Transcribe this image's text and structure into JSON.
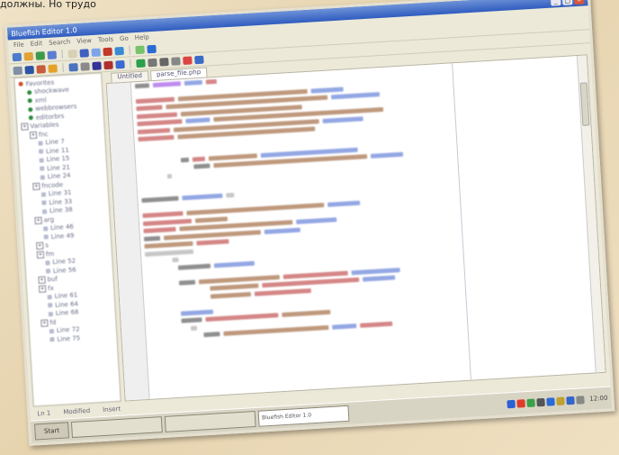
{
  "caption": "должны. Но трудо",
  "window": {
    "title": "Bluefish Editor 1.0",
    "min": "_",
    "max": "□",
    "close": "×"
  },
  "menu": [
    "File",
    "Edit",
    "Search",
    "View",
    "Tools",
    "Go",
    "Help"
  ],
  "toolbar": {
    "row1": [
      "#4a7cc9",
      "#e0a23a",
      "#3c9a4b",
      "#5a7fd0",
      "#d8d0b4",
      "#4060c0",
      "#7da4e8",
      "#c0392b",
      "#3a8ad6",
      "#77c36b",
      "#2b6bd4"
    ],
    "row2": [
      "#7f8fa6",
      "#2b54a8",
      "#c75b3b",
      "#e3a12b",
      "#4a72bf",
      "#8a8a8a",
      "#333399",
      "#b03030",
      "#3c6bd1",
      "#2aa04a",
      "#777",
      "#666",
      "#888",
      "#d44",
      "#3a6bc6"
    ]
  },
  "tree": [
    {
      "depth": 0,
      "type": "dot",
      "color": "#d14d2b",
      "label": "Favorites"
    },
    {
      "depth": 1,
      "type": "dot",
      "color": "#2e8b3c",
      "label": "shockwave"
    },
    {
      "depth": 1,
      "type": "dot",
      "color": "#2e8b3c",
      "label": "xml"
    },
    {
      "depth": 1,
      "type": "dot",
      "color": "#2e8b3c",
      "label": "webbrowsers"
    },
    {
      "depth": 1,
      "type": "dot",
      "color": "#2e8b3c",
      "label": "editorbrs"
    },
    {
      "depth": 0,
      "type": "exp",
      "label": "Variables"
    },
    {
      "depth": 1,
      "type": "exp",
      "label": "fnc"
    },
    {
      "depth": 2,
      "type": "leaf",
      "label": "Line 7"
    },
    {
      "depth": 2,
      "type": "leaf",
      "label": "Line 11"
    },
    {
      "depth": 2,
      "type": "leaf",
      "label": "Line 15"
    },
    {
      "depth": 2,
      "type": "leaf",
      "label": "Line 21"
    },
    {
      "depth": 2,
      "type": "leaf",
      "label": "Line 24"
    },
    {
      "depth": 1,
      "type": "exp",
      "label": "fncode"
    },
    {
      "depth": 2,
      "type": "leaf",
      "label": "Line 31"
    },
    {
      "depth": 2,
      "type": "leaf",
      "label": "Line 33"
    },
    {
      "depth": 2,
      "type": "leaf",
      "label": "Line 38"
    },
    {
      "depth": 1,
      "type": "exp",
      "label": "arg"
    },
    {
      "depth": 2,
      "type": "leaf",
      "label": "Line 46"
    },
    {
      "depth": 2,
      "type": "leaf",
      "label": "Line 49"
    },
    {
      "depth": 1,
      "type": "exp",
      "label": "s"
    },
    {
      "depth": 1,
      "type": "exp",
      "label": "fm"
    },
    {
      "depth": 2,
      "type": "leaf",
      "label": "Line 52"
    },
    {
      "depth": 2,
      "type": "leaf",
      "label": "Line 56"
    },
    {
      "depth": 1,
      "type": "exp",
      "label": "buf"
    },
    {
      "depth": 1,
      "type": "exp",
      "label": "fx"
    },
    {
      "depth": 2,
      "type": "leaf",
      "label": "Line 61"
    },
    {
      "depth": 2,
      "type": "leaf",
      "label": "Line 64"
    },
    {
      "depth": 2,
      "type": "leaf",
      "label": "Line 68"
    },
    {
      "depth": 1,
      "type": "exp",
      "label": "fd"
    },
    {
      "depth": 2,
      "type": "leaf",
      "label": "Line 72"
    },
    {
      "depth": 2,
      "type": "leaf",
      "label": "Line 75"
    }
  ],
  "tabs": [
    {
      "label": "Untitled"
    },
    {
      "label": "parse_file.php",
      "active": true
    }
  ],
  "code": [
    {
      "indent": 0,
      "tokens": [
        [
          "#333",
          "#8a2be2",
          "#3a5fcd",
          "#b22222"
        ],
        [
          18,
          34,
          22,
          14
        ]
      ]
    },
    {
      "indent": 0,
      "tokens": [],
      "widths": []
    },
    {
      "indent": 0,
      "tokens": [
        [
          "#b22222",
          "#8b4513",
          "#3a5fcd"
        ],
        [
          48,
          160,
          40
        ]
      ]
    },
    {
      "indent": 0,
      "tokens": [
        [
          "#b22222",
          "#8b4513",
          "#3a5fcd"
        ],
        [
          32,
          200,
          60
        ]
      ]
    },
    {
      "indent": 0,
      "tokens": [
        [
          "#b22222",
          "#8b4513"
        ],
        [
          50,
          150
        ]
      ]
    },
    {
      "indent": 0,
      "tokens": [
        [
          "#b22222",
          "#3a5fcd",
          "#8b4513"
        ],
        [
          56,
          30,
          210
        ]
      ]
    },
    {
      "indent": 0,
      "tokens": [
        [
          "#b22222",
          "#8b4513",
          "#3a5fcd"
        ],
        [
          40,
          180,
          50
        ]
      ]
    },
    {
      "indent": 0,
      "tokens": [
        [
          "#b22222",
          "#8b4513"
        ],
        [
          44,
          170
        ]
      ]
    },
    {
      "indent": 0,
      "tokens": [],
      "widths": []
    },
    {
      "indent": 0,
      "tokens": [],
      "widths": []
    },
    {
      "indent": 46,
      "tokens": [
        [
          "#333",
          "#b22222",
          "#8b4513",
          "#3a5fcd"
        ],
        [
          10,
          16,
          60,
          120
        ]
      ]
    },
    {
      "indent": 60,
      "tokens": [
        [
          "#333",
          "#8b4513",
          "#3a5fcd"
        ],
        [
          20,
          190,
          40
        ]
      ]
    },
    {
      "indent": 30,
      "tokens": [
        [
          "#999"
        ],
        [
          6
        ]
      ]
    },
    {
      "indent": 0,
      "tokens": [],
      "widths": []
    },
    {
      "indent": 0,
      "tokens": [],
      "widths": []
    },
    {
      "indent": 0,
      "tokens": [
        [
          "#333",
          "#3a5fcd",
          "#999"
        ],
        [
          46,
          50,
          10
        ]
      ]
    },
    {
      "indent": 0,
      "tokens": [],
      "widths": []
    },
    {
      "indent": 0,
      "tokens": [
        [
          "#b22222",
          "#8b4513",
          "#3a5fcd"
        ],
        [
          50,
          170,
          40
        ]
      ]
    },
    {
      "indent": 0,
      "tokens": [
        [
          "#b22222",
          "#8b4513"
        ],
        [
          60,
          40
        ]
      ]
    },
    {
      "indent": 0,
      "tokens": [
        [
          "#b22222",
          "#8b4513",
          "#3a5fcd"
        ],
        [
          40,
          140,
          50
        ]
      ]
    },
    {
      "indent": 0,
      "tokens": [
        [
          "#333",
          "#8b4513",
          "#3a5fcd"
        ],
        [
          20,
          120,
          44
        ]
      ]
    },
    {
      "indent": 0,
      "tokens": [
        [
          "#8b4513",
          "#b22222"
        ],
        [
          60,
          40
        ]
      ]
    },
    {
      "indent": 0,
      "tokens": [
        [
          "#999"
        ],
        [
          60
        ]
      ]
    },
    {
      "indent": 30,
      "tokens": [
        [
          "#999"
        ],
        [
          8
        ]
      ]
    },
    {
      "indent": 36,
      "tokens": [
        [
          "#333",
          "#3a5fcd"
        ],
        [
          40,
          50
        ]
      ]
    },
    {
      "indent": 36,
      "tokens": [],
      "widths": []
    },
    {
      "indent": 36,
      "tokens": [
        [
          "#333",
          "#8b4513",
          "#b22222",
          "#3a5fcd"
        ],
        [
          20,
          100,
          80,
          60
        ]
      ]
    },
    {
      "indent": 70,
      "tokens": [
        [
          "#8b4513",
          "#b22222",
          "#3a5fcd"
        ],
        [
          60,
          120,
          40
        ]
      ]
    },
    {
      "indent": 70,
      "tokens": [
        [
          "#8b4513",
          "#b22222"
        ],
        [
          50,
          70
        ]
      ]
    },
    {
      "indent": 36,
      "tokens": [],
      "widths": []
    },
    {
      "indent": 36,
      "tokens": [
        [
          "#3a5fcd"
        ],
        [
          40
        ]
      ]
    },
    {
      "indent": 36,
      "tokens": [
        [
          "#333",
          "#b22222",
          "#8b4513"
        ],
        [
          26,
          90,
          60
        ]
      ]
    },
    {
      "indent": 46,
      "tokens": [
        [
          "#999"
        ],
        [
          8
        ]
      ]
    },
    {
      "indent": 60,
      "tokens": [
        [
          "#333",
          "#8b4513",
          "#3a5fcd",
          "#b22222"
        ],
        [
          20,
          130,
          30,
          40
        ]
      ]
    }
  ],
  "status": [
    "Ln 1",
    "Modified",
    "Insert"
  ],
  "taskbar": {
    "start": "Start",
    "items": [
      {
        "label": "",
        "active": false
      },
      {
        "label": "",
        "active": false
      },
      {
        "label": "Bluefish Editor 1.0",
        "active": true
      }
    ],
    "tray_colors": [
      "#2b5fd3",
      "#e03a2b",
      "#3aa04a",
      "#555",
      "#2a6ad6",
      "#c0a030",
      "#3366cc",
      "#888"
    ],
    "clock": "12:00"
  }
}
